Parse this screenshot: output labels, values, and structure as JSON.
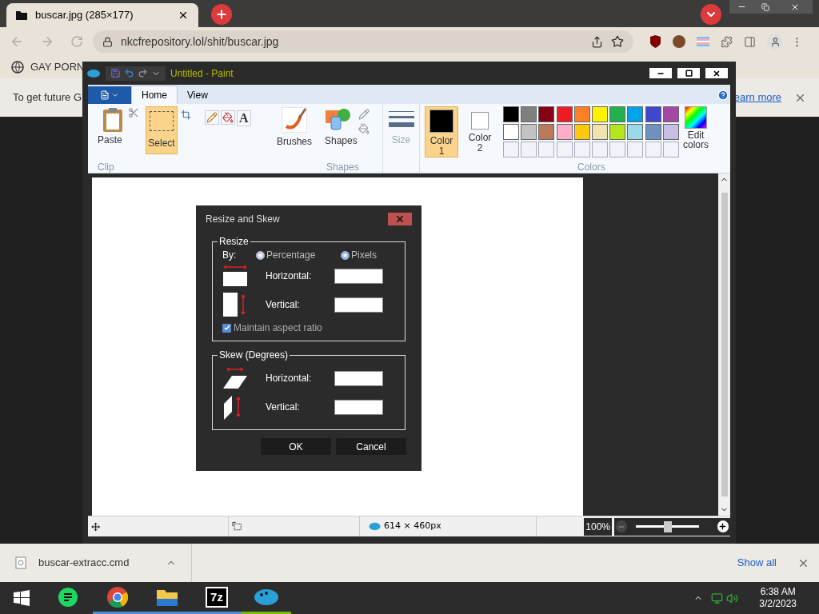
{
  "browser": {
    "tab": {
      "title": "buscar.jpg (285×177)"
    },
    "address": "nkcfrepository.lol/shit/buscar.jpg",
    "bookmarks": [
      {
        "label": "GAY PORN"
      }
    ],
    "infobar": {
      "text": "To get future G",
      "link": "earn more"
    },
    "downloads": [
      {
        "file": "buscar-extracc.cmd"
      }
    ],
    "show_all": "Show all"
  },
  "paint": {
    "title": "Untitled - Paint",
    "tabs": [
      {
        "label": "Home",
        "selected": true
      },
      {
        "label": "View",
        "selected": false
      }
    ],
    "ribbon": {
      "paste": "Paste",
      "clipboard_group": "Clip",
      "select": "Select",
      "text_tool": "A",
      "brushes": "Brushes",
      "shapes": "Shapes",
      "shapes_group": "Shapes",
      "size": "Size",
      "edit_colors": "Edit colors",
      "colors_group": "Colors",
      "color_slots": [
        {
          "label": "Color",
          "number": "1",
          "selected": true,
          "color": "#000000"
        },
        {
          "label": "Color",
          "number": "2",
          "selected": false,
          "color": "#ffffff"
        }
      ],
      "palette": [
        {
          "color": "#000000"
        },
        {
          "color": "#7f7f7f"
        },
        {
          "color": "#880015"
        },
        {
          "color": "#ed1c24"
        },
        {
          "color": "#ff7f27"
        },
        {
          "color": "#fff200"
        },
        {
          "color": "#22b14c"
        },
        {
          "color": "#00a2e8"
        },
        {
          "color": "#3f48cc"
        },
        {
          "color": "#a349a4"
        },
        {
          "color": "#ffffff"
        },
        {
          "color": "#c3c3c3"
        },
        {
          "color": "#b97a57"
        },
        {
          "color": "#ffaec9"
        },
        {
          "color": "#ffc90e"
        },
        {
          "color": "#efe4b0"
        },
        {
          "color": "#b5e61d"
        },
        {
          "color": "#99d9ea"
        },
        {
          "color": "#7092be"
        },
        {
          "color": "#c8bfe7"
        }
      ]
    },
    "status": {
      "size": "614 × 460px",
      "zoom": "100%",
      "zoom_slider": {
        "level": 0.5
      }
    }
  },
  "dialog": {
    "title": "Resize and Skew",
    "resize_legend": "Resize",
    "by": "By:",
    "options": [
      {
        "label": "Percentage",
        "selected": false
      },
      {
        "label": "Pixels",
        "selected": true
      }
    ],
    "resize_rows": [
      {
        "label": "Horizontal:"
      },
      {
        "label": "Vertical:"
      }
    ],
    "maintain": {
      "label": "Maintain aspect ratio",
      "checked": true
    },
    "skew_legend": "Skew (Degrees)",
    "skew_rows": [
      {
        "label": "Horizontal:"
      },
      {
        "label": "Vertical:"
      }
    ],
    "buttons": [
      "OK",
      "Cancel"
    ]
  },
  "taskbar": {
    "apps": [
      {
        "kind": "notes",
        "running": false
      },
      {
        "kind": "chrome",
        "running": true
      },
      {
        "kind": "folder",
        "running": true
      },
      {
        "kind": "zip",
        "label": "7z",
        "running": true
      },
      {
        "kind": "paint",
        "running": true
      }
    ],
    "time": "6:38 AM",
    "date": "3/2/2023"
  }
}
